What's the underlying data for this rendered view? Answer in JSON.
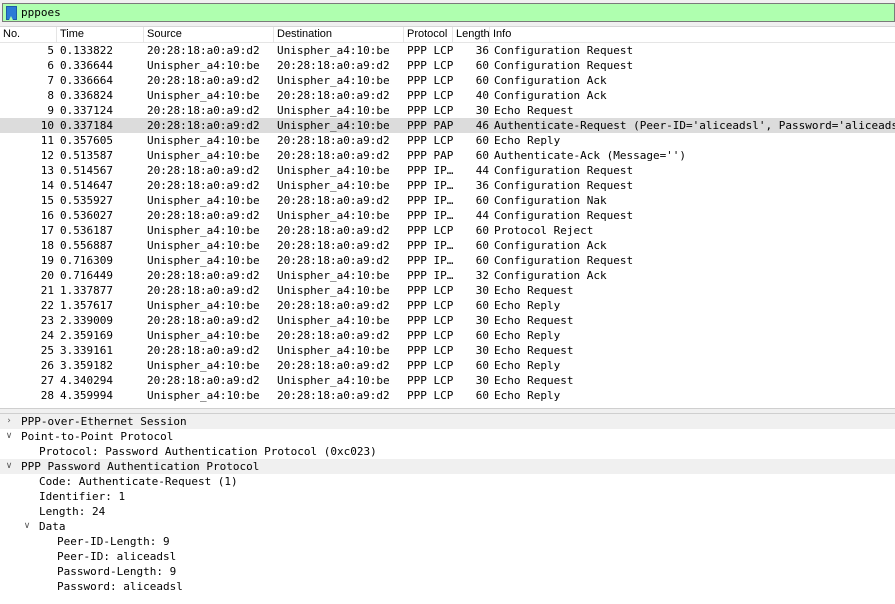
{
  "filter": {
    "value": "pppoes"
  },
  "columns": {
    "no": "No.",
    "time": "Time",
    "source": "Source",
    "destination": "Destination",
    "protocol": "Protocol",
    "length": "Length",
    "info": "Info"
  },
  "packets": [
    {
      "no": "5",
      "time": "0.133822",
      "src": "20:28:18:a0:a9:d2",
      "dst": "Unispher_a4:10:be",
      "proto": "PPP LCP",
      "len": "36",
      "info": "Configuration Request"
    },
    {
      "no": "6",
      "time": "0.336644",
      "src": "Unispher_a4:10:be",
      "dst": "20:28:18:a0:a9:d2",
      "proto": "PPP LCP",
      "len": "60",
      "info": "Configuration Request"
    },
    {
      "no": "7",
      "time": "0.336664",
      "src": "20:28:18:a0:a9:d2",
      "dst": "Unispher_a4:10:be",
      "proto": "PPP LCP",
      "len": "60",
      "info": "Configuration Ack"
    },
    {
      "no": "8",
      "time": "0.336824",
      "src": "Unispher_a4:10:be",
      "dst": "20:28:18:a0:a9:d2",
      "proto": "PPP LCP",
      "len": "40",
      "info": "Configuration Ack"
    },
    {
      "no": "9",
      "time": "0.337124",
      "src": "20:28:18:a0:a9:d2",
      "dst": "Unispher_a4:10:be",
      "proto": "PPP LCP",
      "len": "30",
      "info": "Echo Request"
    },
    {
      "no": "10",
      "time": "0.337184",
      "src": "20:28:18:a0:a9:d2",
      "dst": "Unispher_a4:10:be",
      "proto": "PPP PAP",
      "len": "46",
      "info": "Authenticate-Request (Peer-ID='aliceadsl', Password='aliceadsl')"
    },
    {
      "no": "11",
      "time": "0.357605",
      "src": "Unispher_a4:10:be",
      "dst": "20:28:18:a0:a9:d2",
      "proto": "PPP LCP",
      "len": "60",
      "info": "Echo Reply"
    },
    {
      "no": "12",
      "time": "0.513587",
      "src": "Unispher_a4:10:be",
      "dst": "20:28:18:a0:a9:d2",
      "proto": "PPP PAP",
      "len": "60",
      "info": "Authenticate-Ack (Message='')"
    },
    {
      "no": "13",
      "time": "0.514567",
      "src": "20:28:18:a0:a9:d2",
      "dst": "Unispher_a4:10:be",
      "proto": "PPP IP…",
      "len": "44",
      "info": "Configuration Request"
    },
    {
      "no": "14",
      "time": "0.514647",
      "src": "20:28:18:a0:a9:d2",
      "dst": "Unispher_a4:10:be",
      "proto": "PPP IP…",
      "len": "36",
      "info": "Configuration Request"
    },
    {
      "no": "15",
      "time": "0.535927",
      "src": "Unispher_a4:10:be",
      "dst": "20:28:18:a0:a9:d2",
      "proto": "PPP IP…",
      "len": "60",
      "info": "Configuration Nak"
    },
    {
      "no": "16",
      "time": "0.536027",
      "src": "20:28:18:a0:a9:d2",
      "dst": "Unispher_a4:10:be",
      "proto": "PPP IP…",
      "len": "44",
      "info": "Configuration Request"
    },
    {
      "no": "17",
      "time": "0.536187",
      "src": "Unispher_a4:10:be",
      "dst": "20:28:18:a0:a9:d2",
      "proto": "PPP LCP",
      "len": "60",
      "info": "Protocol Reject"
    },
    {
      "no": "18",
      "time": "0.556887",
      "src": "Unispher_a4:10:be",
      "dst": "20:28:18:a0:a9:d2",
      "proto": "PPP IP…",
      "len": "60",
      "info": "Configuration Ack"
    },
    {
      "no": "19",
      "time": "0.716309",
      "src": "Unispher_a4:10:be",
      "dst": "20:28:18:a0:a9:d2",
      "proto": "PPP IP…",
      "len": "60",
      "info": "Configuration Request"
    },
    {
      "no": "20",
      "time": "0.716449",
      "src": "20:28:18:a0:a9:d2",
      "dst": "Unispher_a4:10:be",
      "proto": "PPP IP…",
      "len": "32",
      "info": "Configuration Ack"
    },
    {
      "no": "21",
      "time": "1.337877",
      "src": "20:28:18:a0:a9:d2",
      "dst": "Unispher_a4:10:be",
      "proto": "PPP LCP",
      "len": "30",
      "info": "Echo Request"
    },
    {
      "no": "22",
      "time": "1.357617",
      "src": "Unispher_a4:10:be",
      "dst": "20:28:18:a0:a9:d2",
      "proto": "PPP LCP",
      "len": "60",
      "info": "Echo Reply"
    },
    {
      "no": "23",
      "time": "2.339009",
      "src": "20:28:18:a0:a9:d2",
      "dst": "Unispher_a4:10:be",
      "proto": "PPP LCP",
      "len": "30",
      "info": "Echo Request"
    },
    {
      "no": "24",
      "time": "2.359169",
      "src": "Unispher_a4:10:be",
      "dst": "20:28:18:a0:a9:d2",
      "proto": "PPP LCP",
      "len": "60",
      "info": "Echo Reply"
    },
    {
      "no": "25",
      "time": "3.339161",
      "src": "20:28:18:a0:a9:d2",
      "dst": "Unispher_a4:10:be",
      "proto": "PPP LCP",
      "len": "30",
      "info": "Echo Request"
    },
    {
      "no": "26",
      "time": "3.359182",
      "src": "Unispher_a4:10:be",
      "dst": "20:28:18:a0:a9:d2",
      "proto": "PPP LCP",
      "len": "60",
      "info": "Echo Reply"
    },
    {
      "no": "27",
      "time": "4.340294",
      "src": "20:28:18:a0:a9:d2",
      "dst": "Unispher_a4:10:be",
      "proto": "PPP LCP",
      "len": "30",
      "info": "Echo Request"
    },
    {
      "no": "28",
      "time": "4.359994",
      "src": "Unispher_a4:10:be",
      "dst": "20:28:18:a0:a9:d2",
      "proto": "PPP LCP",
      "len": "60",
      "info": "Echo Reply"
    }
  ],
  "selected_packet_no": "10",
  "details": {
    "pppoe": "PPP-over-Ethernet Session",
    "ppp": "Point-to-Point Protocol",
    "ppp_protocol": "Protocol: Password Authentication Protocol (0xc023)",
    "pap": "PPP Password Authentication Protocol",
    "code": "Code: Authenticate-Request (1)",
    "identifier": "Identifier: 1",
    "length": "Length: 24",
    "data": "Data",
    "peer_id_length": "Peer-ID-Length: 9",
    "peer_id": "Peer-ID: aliceadsl",
    "password_length": "Password-Length: 9",
    "password": "Password: aliceadsl"
  },
  "icons": {
    "filter_bookmark": "bookmark-icon",
    "collapsed": "chevron-right-icon",
    "expanded": "chevron-down-icon"
  },
  "colors": {
    "filter_valid_bg": "#afffaf",
    "selected_row_bg": "#dcdcdc",
    "tree_row_shade": "#f0f0f0"
  }
}
